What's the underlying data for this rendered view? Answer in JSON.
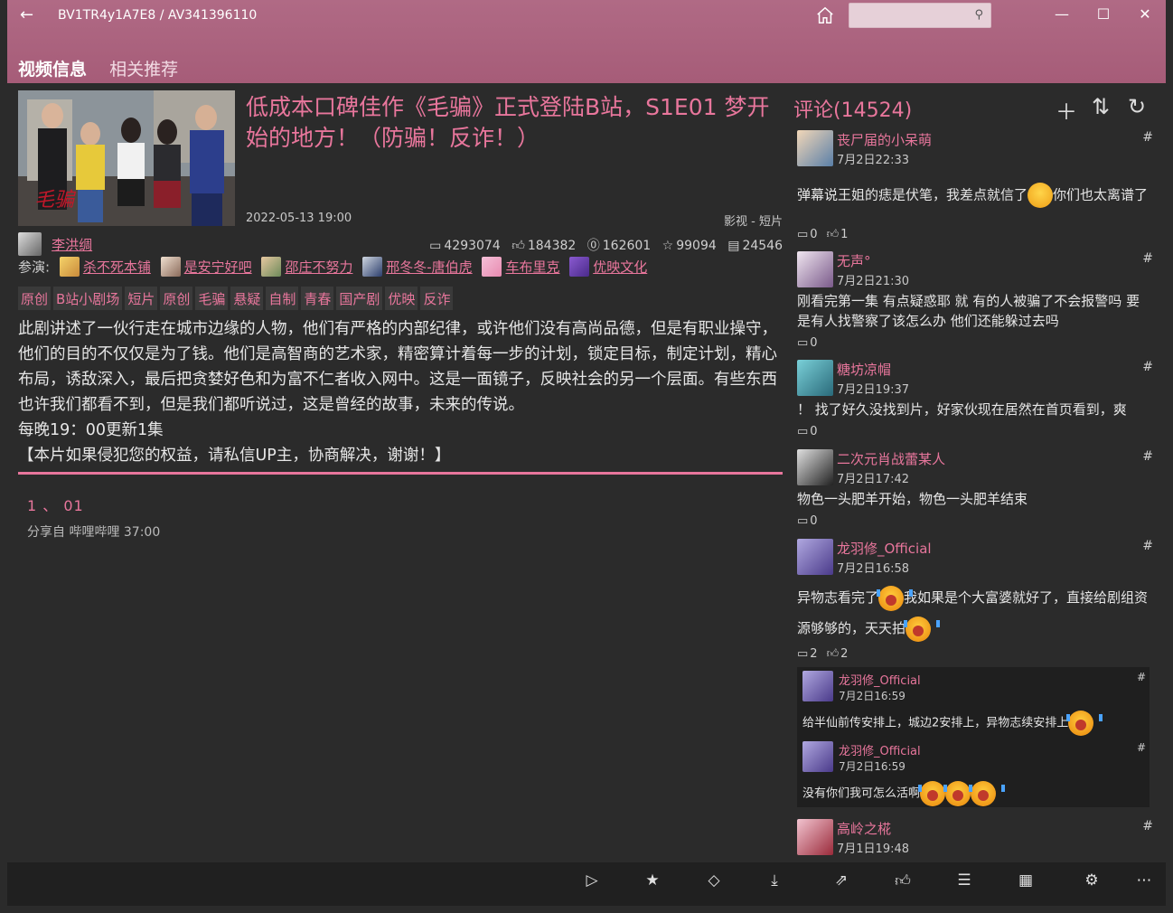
{
  "window": {
    "title": "BV1TR4y1A7E8 / AV341396110",
    "search_placeholder": "",
    "minimize": "—",
    "maximize": "☐",
    "close": "✕"
  },
  "tabs": [
    "视频信息",
    "相关推荐"
  ],
  "video": {
    "title": "低成本口碑佳作《毛骗》正式登陆B站，S1E01 梦开始的地方！（防骗！反诈！）",
    "date": "2022-05-13 19:00",
    "category": "影视 - 短片",
    "uploader": "李洪绸",
    "stats": {
      "views": "4293074",
      "likes": "184382",
      "coins": "162601",
      "favorites": "99094",
      "danmaku": "24546"
    },
    "cast_label": "参演:",
    "cast": [
      "杀不死本铺",
      "是安宁好吧",
      "邵庄不努力",
      "邢冬冬-唐伯虎",
      "车布里克",
      "优映文化"
    ],
    "tags": [
      "原创",
      "B站小剧场",
      "短片",
      "原创",
      "毛骗",
      "悬疑",
      "自制",
      "青春",
      "国产剧",
      "优映",
      "反诈"
    ],
    "description": "此剧讲述了一伙行走在城市边缘的人物，他们有严格的内部纪律，或许他们没有高尚品德，但是有职业操守，他们的目的不仅仅是为了钱。他们是高智商的艺术家，精密算计着每一步的计划，锁定目标，制定计划，精心布局，诱敌深入，最后把贪婪好色和为富不仁者收入网中。这是一面镜子，反映社会的另一个层面。有些东西也许我们都看不到，但是我们都听说过，这是曾经的故事，未来的传说。",
    "schedule": "每晚19：00更新1集",
    "notice": "【本片如果侵犯您的权益，请私信UP主，协商解决，谢谢！】",
    "episode": {
      "title": "1 、 01",
      "subtitle": "分享自 哔哩哔哩 37:00"
    }
  },
  "comments": {
    "header": "评论(14524)",
    "items": [
      {
        "name": "丧尸届的小呆萌",
        "time": "7月2日22:33",
        "text_a": "弹幕说王姐的痣是伏笔，我差点就信了",
        "text_b": "你们也太离谱了",
        "replies": "0",
        "likes": "1"
      },
      {
        "name": "无声°",
        "time": "7月2日21:30",
        "text": "刚看完第一集 有点疑惑耶 就 有的人被骗了不会报警吗 要是有人找警察了该怎么办 他们还能躲过去吗",
        "replies": "0"
      },
      {
        "name": "糖坊凉帽",
        "time": "7月2日19:37",
        "text": "！ 找了好久没找到片，好家伙现在居然在首页看到，爽",
        "replies": "0"
      },
      {
        "name": "二次元肖战蕾某人",
        "time": "7月2日17:42",
        "text": "物色一头肥羊开始，物色一头肥羊结束",
        "replies": "0"
      },
      {
        "name": "龙羽修_Official",
        "time": "7月2日16:58",
        "text_a": "异物志看完了",
        "text_b": "我如果是个大富婆就好了，直接给剧组资源够够的，天天拍",
        "replies": "2",
        "likes": "2"
      },
      {
        "name": "高岭之椛",
        "time": "7月1日19:48"
      }
    ],
    "sub_replies": [
      {
        "name": "龙羽修_Official",
        "time": "7月2日16:59",
        "text": "给半仙前传安排上，城边2安排上，异物志续安排上"
      },
      {
        "name": "龙羽修_Official",
        "time": "7月2日16:59",
        "text": "没有你们我可怎么活啊"
      }
    ],
    "hash": "#"
  },
  "colors": {
    "accent": "#e8769c",
    "header": "#a65c78",
    "background": "#2b2b2b"
  }
}
